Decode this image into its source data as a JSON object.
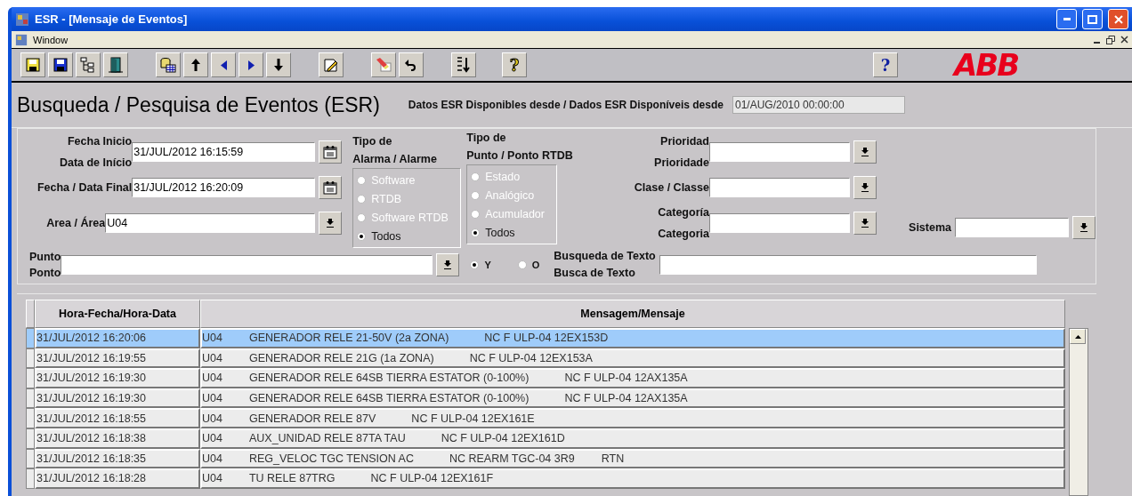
{
  "window": {
    "title": "ESR - [Mensaje de Eventos]"
  },
  "menu": [
    "Window"
  ],
  "toolbar": {
    "help_label": "?",
    "logo": "ABB",
    "tool_help_label": "?"
  },
  "header": {
    "title": "Busqueda / Pesquisa de Eventos (ESR)",
    "available_label": "Datos ESR Disponibles desde / Dados ESR Disponíveis desde",
    "available_value": "01/AUG/2010 00:00:00"
  },
  "form": {
    "start": {
      "label": [
        "Fecha Inicio",
        "Data de Início"
      ],
      "value": "31/JUL/2012 16:15:59"
    },
    "end": {
      "label": [
        "Fecha / Data Final"
      ],
      "value": "31/JUL/2012 16:20:09"
    },
    "area": {
      "label": [
        "Area / Área"
      ],
      "value": "U04"
    },
    "alarm_type": {
      "label": [
        "Tipo de",
        "Alarma / Alarme"
      ],
      "options": [
        {
          "label": "Software",
          "selected": false
        },
        {
          "label": "RTDB",
          "selected": false
        },
        {
          "label": "Software RTDB",
          "selected": false
        },
        {
          "label": "Todos",
          "selected": true
        }
      ]
    },
    "point_type": {
      "label": [
        "Tipo de",
        "Punto / Ponto RTDB"
      ],
      "options": [
        {
          "label": "Estado",
          "selected": false
        },
        {
          "label": "Analógico",
          "selected": false
        },
        {
          "label": "Acumulador",
          "selected": false
        },
        {
          "label": "Todos",
          "selected": true
        }
      ]
    },
    "priority": {
      "label": [
        "Prioridad",
        "Prioridade"
      ]
    },
    "class": {
      "label": [
        "Clase / Classe"
      ]
    },
    "category": {
      "label": [
        "Categoría",
        "Categoria"
      ]
    },
    "system": {
      "label": [
        "Sistema"
      ]
    },
    "point": {
      "label": [
        "Punto",
        "Ponto"
      ]
    },
    "logic": [
      {
        "label": "Y",
        "selected": true
      },
      {
        "label": "O",
        "selected": false
      }
    ],
    "text_search": {
      "label": [
        "Busqueda de Texto",
        "Busca de Texto"
      ]
    }
  },
  "table": {
    "columns": [
      "Hora-Fecha/Hora-Data",
      "Mensagem/Mensaje"
    ],
    "rows": [
      {
        "time": "31/JUL/2012 16:20:06",
        "unit": "U04",
        "text": "GENERADOR RELE 21-50V (2a ZONA)",
        "code": "NC F ULP-04 12EX153D",
        "selected": true
      },
      {
        "time": "31/JUL/2012 16:19:55",
        "unit": "U04",
        "text": "GENERADOR RELE 21G (1a ZONA)",
        "code": "NC F ULP-04 12EX153A",
        "selected": false
      },
      {
        "time": "31/JUL/2012 16:19:30",
        "unit": "U04",
        "text": "GENERADOR RELE 64SB TIERRA ESTATOR (0-100%)",
        "code": "NC F ULP-04 12AX135A",
        "selected": false
      },
      {
        "time": "31/JUL/2012 16:19:30",
        "unit": "U04",
        "text": "GENERADOR RELE 64SB TIERRA ESTATOR (0-100%)",
        "code": "NC F ULP-04 12AX135A",
        "selected": false
      },
      {
        "time": "31/JUL/2012 16:18:55",
        "unit": "U04",
        "text": "GENERADOR RELE 87V",
        "code": "NC F ULP-04 12EX161E",
        "selected": false
      },
      {
        "time": "31/JUL/2012 16:18:38",
        "unit": "U04",
        "text": "AUX_UNIDAD RELE 87TA TAU",
        "code": "NC F ULP-04 12EX161D",
        "selected": false
      },
      {
        "time": "31/JUL/2012 16:18:35",
        "unit": "U04",
        "text": "REG_VELOC TGC TENSION AC",
        "code": "NC REARM TGC-04 3R9",
        "extra": "RTN",
        "selected": false
      },
      {
        "time": "31/JUL/2012 16:18:28",
        "unit": "U04",
        "text": "TU RELE 87TRG",
        "code": "NC F ULP-04 12EX161F",
        "selected": false
      }
    ]
  }
}
